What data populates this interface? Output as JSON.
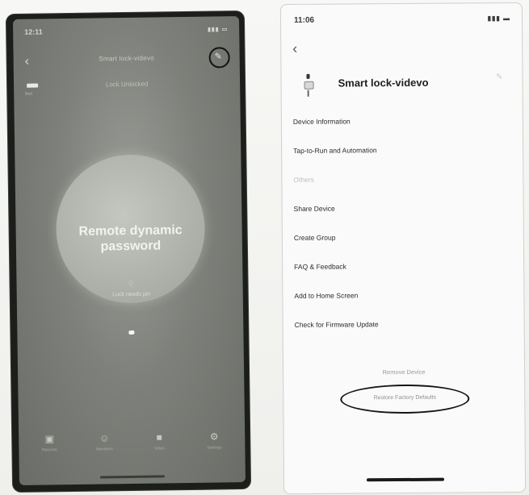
{
  "left_screen": {
    "status_time": "12:11",
    "status_icons": "▮▮▮ ▭",
    "title": "Smart lock-videvo",
    "status_line": "Lock Unlocked",
    "battery_label": "Batt",
    "password_title": "Remote dynamic\npassword",
    "password_subtitle": "Lock needs pin",
    "tabs": [
      {
        "icon": "lock-icon",
        "glyph": "▣",
        "label": "Records"
      },
      {
        "icon": "user-icon",
        "glyph": "☺",
        "label": "Members"
      },
      {
        "icon": "camera-icon",
        "glyph": "■",
        "label": "Video"
      },
      {
        "icon": "settings-icon",
        "glyph": "⚙",
        "label": "Settings"
      }
    ]
  },
  "right_screen": {
    "status_time": "11:06",
    "status_icons": "▮▮▮ ▬",
    "device_title": "Smart lock-videvo",
    "menu_items": [
      {
        "label": "Device Information",
        "faint": false
      },
      {
        "label": "Tap-to-Run and Automation",
        "faint": false
      },
      {
        "label": "Others",
        "faint": true
      },
      {
        "label": "Share Device",
        "faint": false
      },
      {
        "label": "Create Group",
        "faint": false
      },
      {
        "label": "FAQ & Feedback",
        "faint": false
      },
      {
        "label": "Add to Home Screen",
        "faint": false
      },
      {
        "label": "Check for Firmware Update",
        "faint": false
      }
    ],
    "remove_device": "Remove Device",
    "restore_factory": "Restore Factory Defaults"
  }
}
